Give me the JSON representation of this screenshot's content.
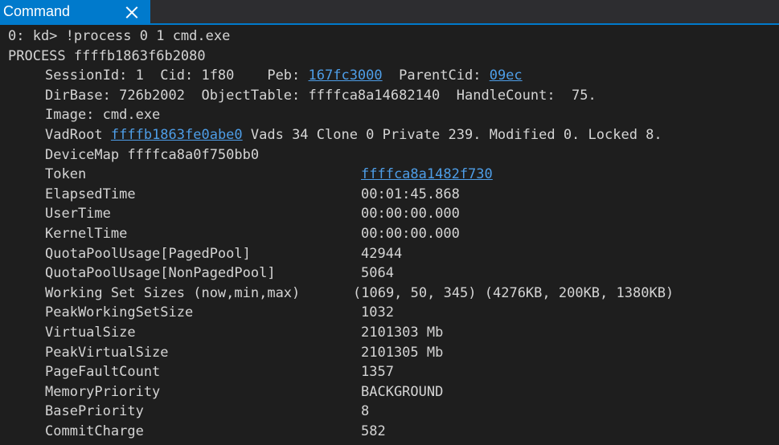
{
  "tab": {
    "title": "Command"
  },
  "prompt_line": "0: kd> !process 0 1 cmd.exe",
  "process_line": "PROCESS ffffb1863f6b2080",
  "session": {
    "sessionid_label": "SessionId: 1  Cid: 1f80    Peb: ",
    "peb": "167fc3000",
    "parentcid_label": "  ParentCid: ",
    "parentcid": "09ec"
  },
  "dirbase_line": "DirBase: 726b2002  ObjectTable: ffffca8a14682140  HandleCount:  75.",
  "image_line": "Image: cmd.exe",
  "vad": {
    "label": "VadRoot ",
    "root": "ffffb1863fe0abe0",
    "rest": " Vads 34 Clone 0 Private 239. Modified 0. Locked 8."
  },
  "devicemap_line": "DeviceMap ffffca8a0f750bb0",
  "fields": [
    {
      "key": "Token",
      "value": "ffffca8a1482f730",
      "link": true
    },
    {
      "key": "ElapsedTime",
      "value": "00:01:45.868"
    },
    {
      "key": "UserTime",
      "value": "00:00:00.000"
    },
    {
      "key": "KernelTime",
      "value": "00:00:00.000"
    },
    {
      "key": "QuotaPoolUsage[PagedPool]",
      "value": "42944"
    },
    {
      "key": "QuotaPoolUsage[NonPagedPool]",
      "value": "5064"
    },
    {
      "key": "Working Set Sizes (now,min,max)",
      "value": "(1069, 50, 345) (4276KB, 200KB, 1380KB)"
    },
    {
      "key": "PeakWorkingSetSize",
      "value": "1032"
    },
    {
      "key": "VirtualSize",
      "value": "2101303 Mb"
    },
    {
      "key": "PeakVirtualSize",
      "value": "2101305 Mb"
    },
    {
      "key": "PageFaultCount",
      "value": "1357"
    },
    {
      "key": "MemoryPriority",
      "value": "BACKGROUND"
    },
    {
      "key": "BasePriority",
      "value": "8"
    },
    {
      "key": "CommitCharge",
      "value": "582"
    }
  ],
  "colors": {
    "background": "#1e1e1e",
    "text": "#d4d4d4",
    "link": "#4e9ee8",
    "accent": "#007acc"
  },
  "icons": {
    "close": "close-icon"
  }
}
